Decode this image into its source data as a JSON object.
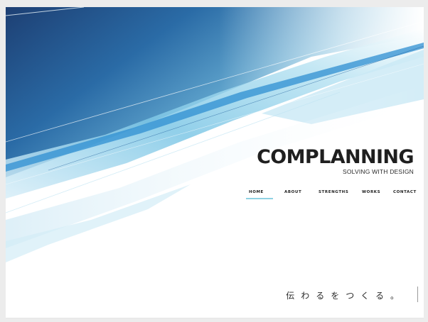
{
  "brand": {
    "logo": "COMPLANNING",
    "tagline": "SOLVING WITH DESIGN"
  },
  "nav": {
    "items": [
      {
        "label": "HOME",
        "active": true
      },
      {
        "label": "ABOUT",
        "active": false
      },
      {
        "label": "STRENGTHS",
        "active": false
      },
      {
        "label": "WORKS",
        "active": false
      },
      {
        "label": "CONTACT",
        "active": false
      }
    ]
  },
  "hero": {
    "catchphrase": "伝わるをつくる。"
  },
  "colors": {
    "accent": "#8fd2e3",
    "deep_blue": "#1b4f86",
    "sky_blue": "#57b7de",
    "text": "#1f1f1f"
  }
}
